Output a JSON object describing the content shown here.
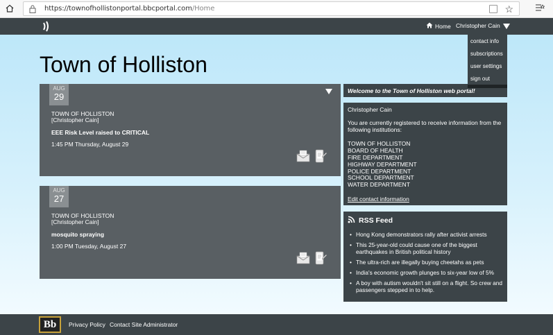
{
  "browser": {
    "url_host": "https://townofhollistonportal.bbcportal.com",
    "url_path": "/Home"
  },
  "header": {
    "logo_glyph": "))",
    "home_label": "Home",
    "user_name": "Christopher Cain"
  },
  "user_menu": {
    "items": [
      "contact info",
      "subscriptions",
      "user settings",
      "sign out"
    ]
  },
  "page_title": "Town of Holliston",
  "messages": [
    {
      "month": "AUG",
      "day": "29",
      "org": "TOWN OF HOLLISTON",
      "sender": "[Christopher Cain]",
      "subject": "EEE Risk Level raised to CRITICAL",
      "when": "1:45 PM Thursday, August 29"
    },
    {
      "month": "AUG",
      "day": "27",
      "org": "TOWN OF HOLLISTON",
      "sender": "[Christopher Cain]",
      "subject": "mosquito spraying",
      "when": "1:00 PM Tuesday, August 27"
    }
  ],
  "welcome_text": "Welcome to the Town of Holliston web portal!",
  "registration": {
    "name": "Christopher Cain",
    "intro": "You are currently registered to receive information from the following institutions:",
    "institutions": [
      "TOWN OF HOLLISTON",
      "BOARD OF HEALTH",
      "FIRE DEPARTMENT",
      "HIGHWAY DEPARTMENT",
      "POLICE DEPARTMENT",
      "SCHOOL DEPARTMENT",
      "WATER DEPARTMENT"
    ],
    "edit_link": "Edit contact information"
  },
  "rss": {
    "title": "RSS Feed",
    "items": [
      "Hong Kong demonstrators rally after activist arrests",
      "This 25-year-old could cause one of the biggest earthquakes in British political history",
      "The ultra-rich are illegally buying cheetahs as pets",
      "India's economic growth plunges to six-year low of 5%",
      "A boy with autism wouldn't sit still on a flight. So crew and passengers stepped in to help."
    ]
  },
  "footer": {
    "logo_text": "Bb",
    "privacy": "Privacy Policy",
    "contact_admin": "Contact Site Administrator"
  },
  "colors": {
    "header_bg": "#3c4448",
    "card_bg": "#595f63",
    "page_bg_top": "#bde7f9"
  }
}
